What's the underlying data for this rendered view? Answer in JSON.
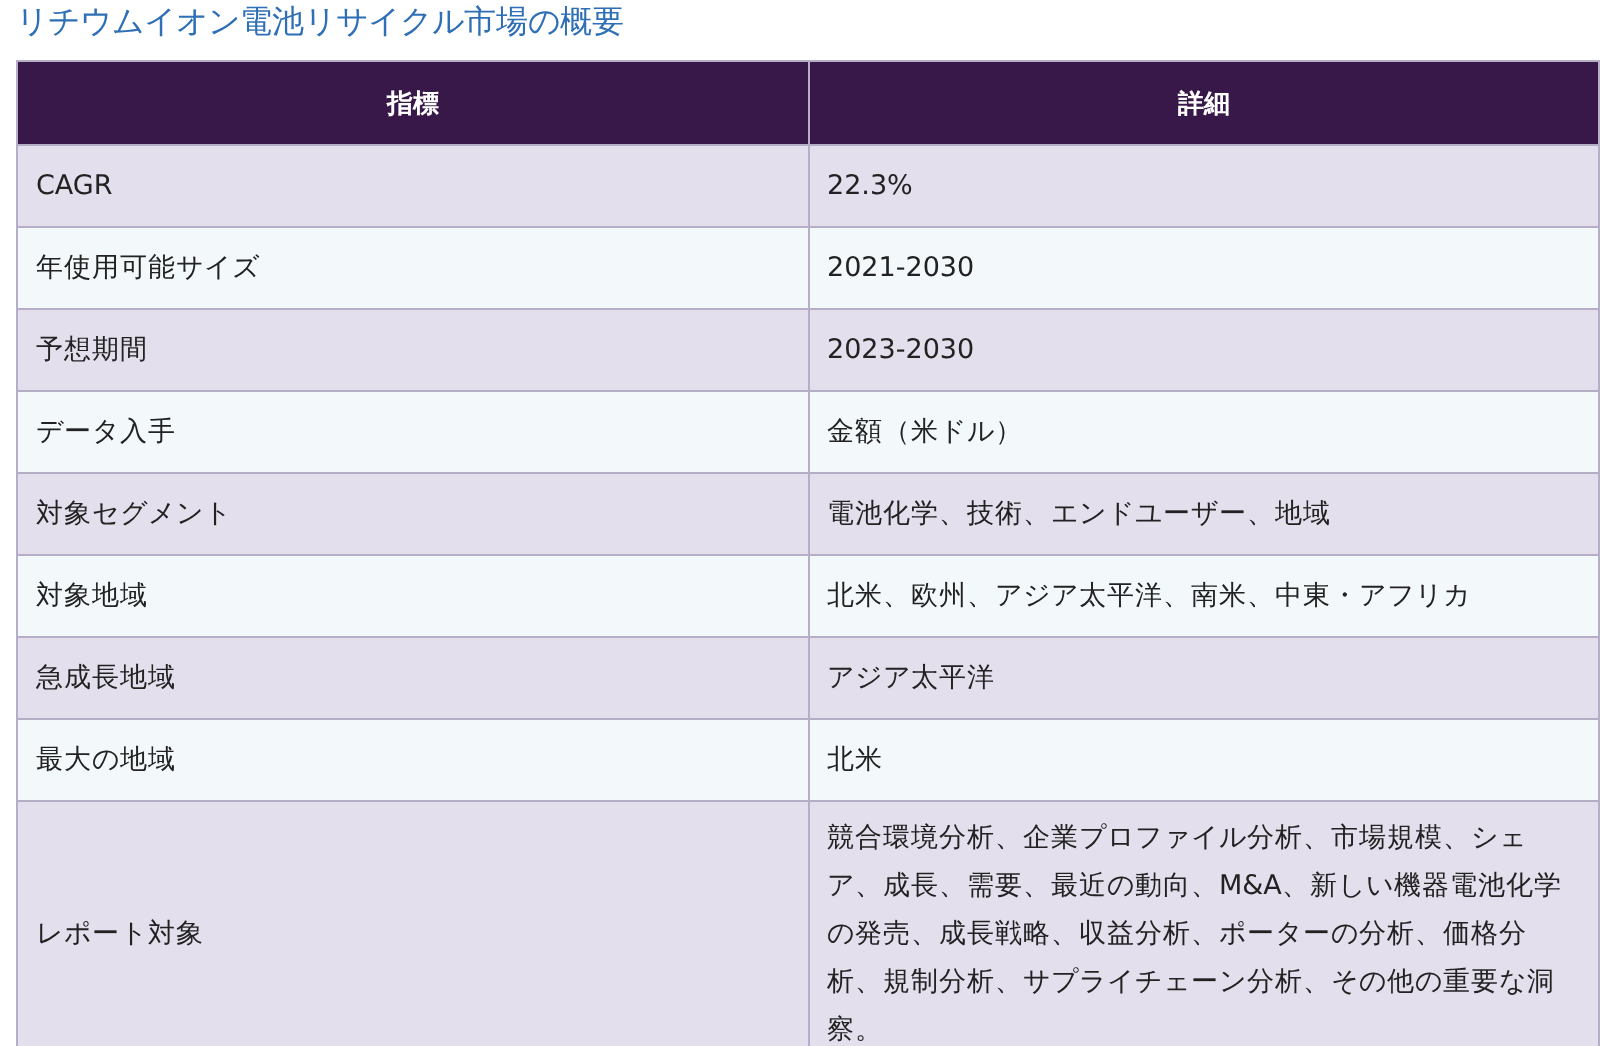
{
  "title": "リチウムイオン電池リサイクル市場の概要",
  "table": {
    "columns": [
      "指標",
      "詳細"
    ],
    "rows": [
      {
        "cells": [
          "CAGR",
          "22.3%"
        ]
      },
      {
        "cells": [
          "年使用可能サイズ",
          "2021-2030"
        ]
      },
      {
        "cells": [
          "予想期間",
          "2023-2030"
        ]
      },
      {
        "cells": [
          "データ入手",
          "金額（米ドル）"
        ]
      },
      {
        "cells": [
          "対象セグメント",
          "電池化学、技術、エンドユーザー、地域"
        ]
      },
      {
        "cells": [
          "対象地域",
          "北米、欧州、アジア太平洋、南米、中東・アフリカ"
        ]
      },
      {
        "cells": [
          "急成長地域",
          "アジア太平洋"
        ]
      },
      {
        "cells": [
          "最大の地域",
          "北米"
        ]
      },
      {
        "cells": [
          "レポート対象",
          "競合環境分析、企業プロファイル分析、市場規模、シェア、成長、需要、最近の動向、M&A、新しい機器電池化学の発売、成長戦略、収益分析、ポーターの分析、価格分析、規制分析、サプライチェーン分析、その他の重要な洞察。"
        ]
      }
    ]
  }
}
